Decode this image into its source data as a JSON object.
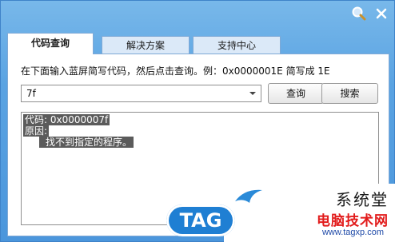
{
  "titlebar": {
    "search_icon": "search-icon",
    "close_icon": "close-icon"
  },
  "tabs": [
    {
      "label": "代码查询",
      "active": true
    },
    {
      "label": "解决方案",
      "active": false
    },
    {
      "label": "支持中心",
      "active": false
    }
  ],
  "query": {
    "hint": "在下面输入蓝屏简写代码，然后点击查询。例：0x0000001E 简写成 1E",
    "code_value": "7f",
    "query_button": "查询",
    "search_button": "搜索"
  },
  "result": {
    "line1": "代码: 0x0000007f",
    "line2": "原因:",
    "line3": "找不到指定的程序。"
  },
  "watermark": {
    "site_name": "系统堂",
    "main_text": "电脑技术网",
    "url": "www.tagxp.com",
    "logo_text": "TAG"
  },
  "colors": {
    "title_gradient_top": "#78b8ea",
    "title_gradient_bottom": "#4b96dc",
    "selection_bg": "#5b5b5b",
    "watermark_red": "#e21b1b"
  }
}
